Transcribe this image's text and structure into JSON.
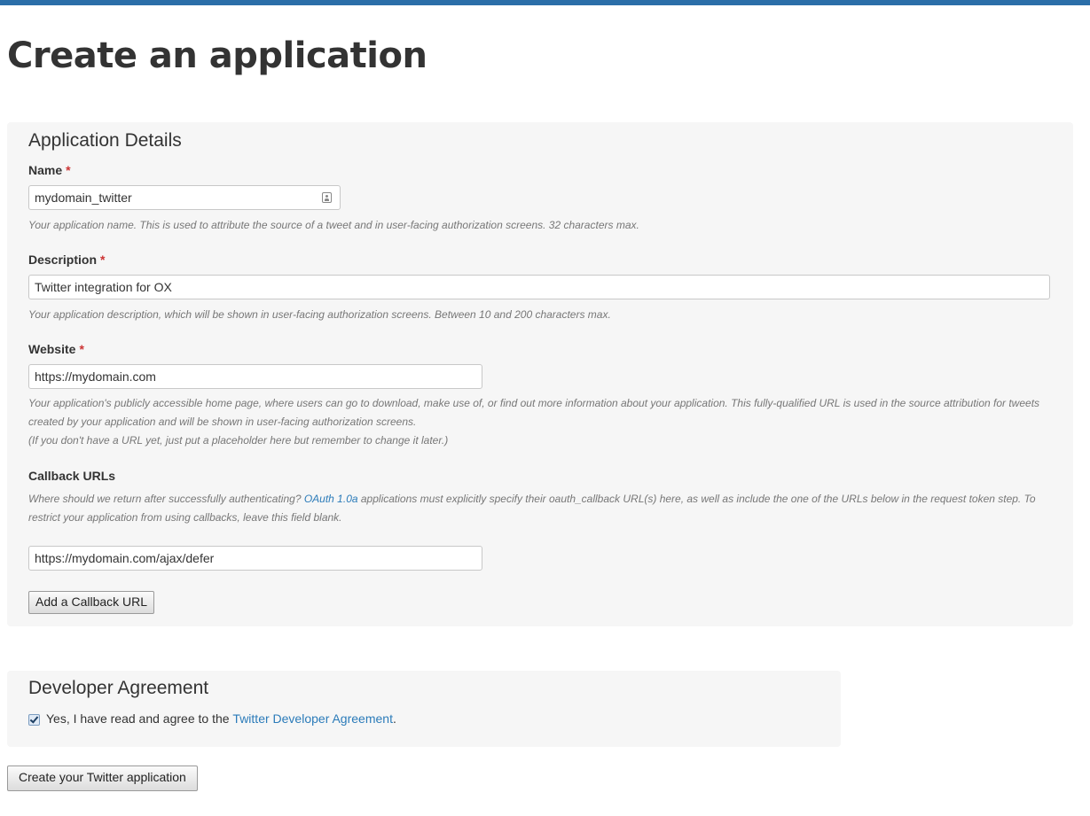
{
  "page": {
    "title": "Create an application"
  },
  "application_details": {
    "legend": "Application Details",
    "required_marker": "*",
    "name": {
      "label": "Name",
      "value": "mydomain_twitter",
      "help": "Your application name. This is used to attribute the source of a tweet and in user-facing authorization screens. 32 characters max."
    },
    "description": {
      "label": "Description",
      "value": "Twitter integration for OX",
      "help": "Your application description, which will be shown in user-facing authorization screens. Between 10 and 200 characters max."
    },
    "website": {
      "label": "Website",
      "value": "https://mydomain.com",
      "help_line1": "Your application's publicly accessible home page, where users can go to download, make use of, or find out more information about your application. This fully-qualified URL is used in the source attribution for tweets",
      "help_line2": "created by your application and will be shown in user-facing authorization screens.",
      "help_line3": "(If you don't have a URL yet, just put a placeholder here but remember to change it later.)"
    },
    "callback": {
      "label": "Callback URLs",
      "help_prefix": "Where should we return after successfully authenticating? ",
      "help_link": "OAuth 1.0a",
      "help_suffix_line1": " applications must explicitly specify their oauth_callback URL(s) here, as well as include the one of the URLs below in the request token step. To",
      "help_line2": "restrict your application from using callbacks, leave this field blank.",
      "value": "https://mydomain.com/ajax/defer",
      "add_button": "Add a Callback URL"
    }
  },
  "developer_agreement": {
    "legend": "Developer Agreement",
    "checked": true,
    "text_prefix": "Yes, I have read and agree to the ",
    "link_text": "Twitter Developer Agreement",
    "text_suffix": "."
  },
  "submit": {
    "label": "Create your Twitter application"
  },
  "colors": {
    "accent": "#2b6ea8",
    "link": "#2b7bb9",
    "required": "#cc3333",
    "panel_bg": "#f6f6f6"
  }
}
